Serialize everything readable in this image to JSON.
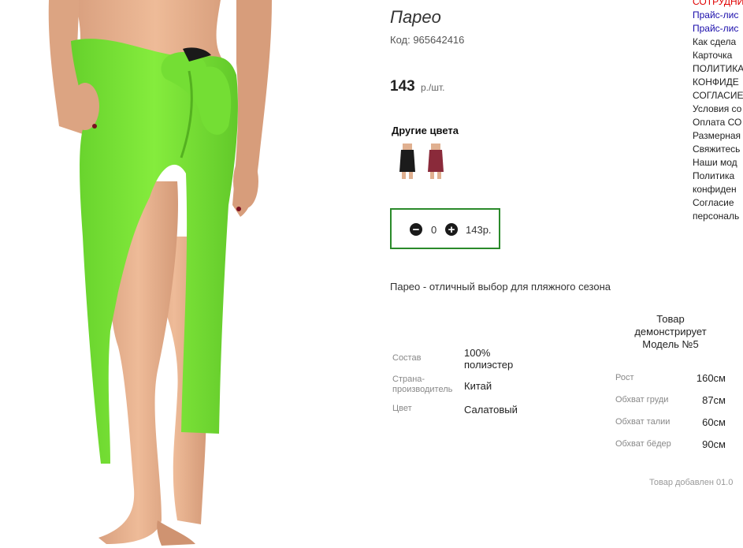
{
  "product": {
    "title": "Парео",
    "code": "Код: 965642416",
    "price": "143",
    "price_unit": "р./шт.",
    "other_colors_label": "Другие цвета",
    "other_colors": [
      {
        "icon": "black-pareo-thumbnail"
      },
      {
        "icon": "burgundy-pareo-thumbnail"
      }
    ],
    "quantity": "0",
    "total": "143р.",
    "description": "Парео - отличный выбор для пляжного сезона",
    "specs": [
      {
        "label": "Состав",
        "value": "100% полиэстер"
      },
      {
        "label": "Страна-производитель",
        "value": "Китай"
      },
      {
        "label": "Цвет",
        "value": "Салатовый"
      }
    ],
    "model": {
      "title": "Товар демонстрирует Модель №5",
      "measurements": [
        {
          "label": "Рост",
          "value": "160см"
        },
        {
          "label": "Обхват груди",
          "value": "87см"
        },
        {
          "label": "Обхват талии",
          "value": "60см"
        },
        {
          "label": "Обхват бёдер",
          "value": "90см"
        }
      ]
    },
    "added_text": "Товар добавлен 01.0"
  },
  "sidebar": {
    "links": [
      "СОТРУДНИ",
      "Прайс-лис",
      "Прайс-лис",
      "Как сдела",
      "Карточка",
      "ПОЛИТИКА",
      "КОНФИДЕ",
      "СОГЛАСИЕ",
      "Условия со",
      "Оплата СО",
      "Размерная",
      "Свяжитесь",
      "Наши мод",
      "Политика",
      "конфиден",
      "Согласие",
      "персональ"
    ]
  },
  "colors": {
    "accent_border": "#2a8a2a",
    "pareo_green": "#7ee53a",
    "link_blue": "#1a0dab",
    "link_red": "#e00000"
  }
}
